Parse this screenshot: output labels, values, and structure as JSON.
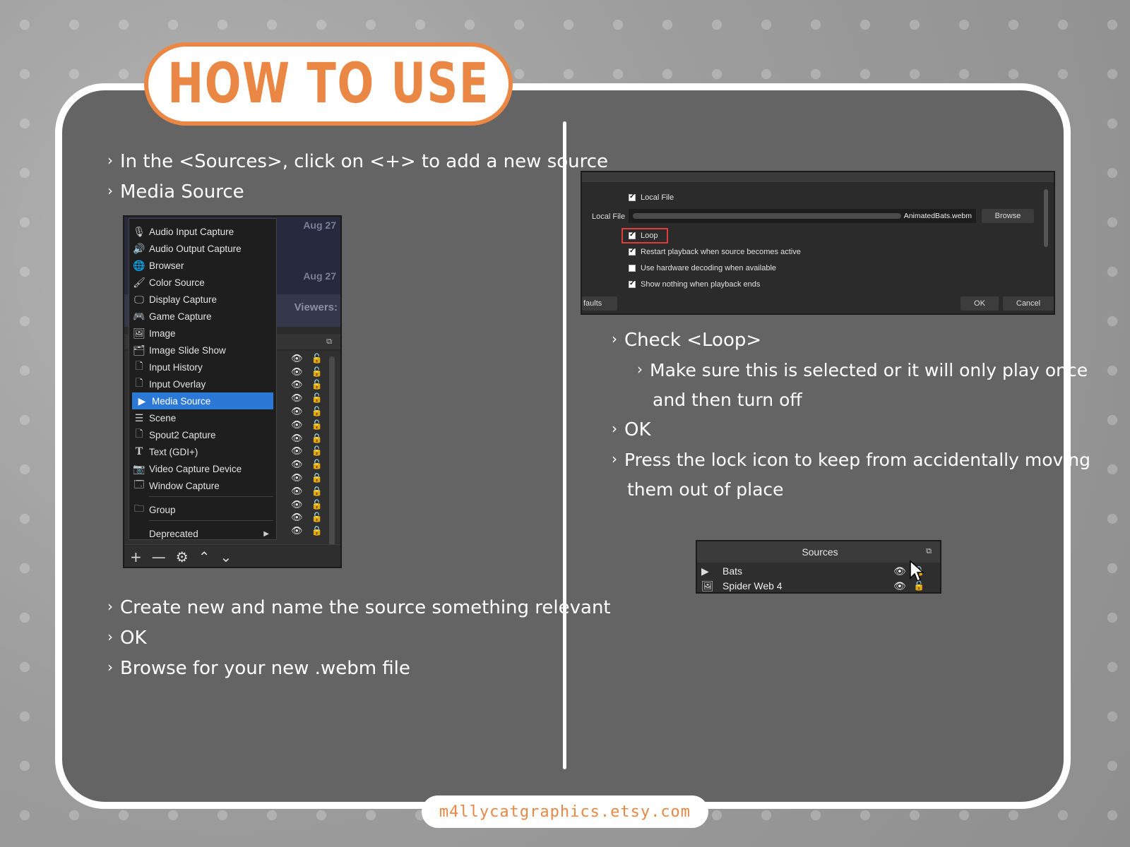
{
  "title": "HOW TO USE",
  "footer": "m4llycatgraphics.etsy.com",
  "left_steps": [
    "In the <Sources>, click on <+> to add a new source",
    "Media Source"
  ],
  "left_steps_bottom": [
    "Create new and name the source something relevant",
    "OK",
    "Browse for your new .webm file"
  ],
  "right_steps": {
    "check_loop": "Check <Loop>",
    "sub_line1": "Make sure this is selected or it will only play once",
    "sub_line2": "and then turn off",
    "ok": "OK",
    "lock_line1": "Press the lock icon to keep from accidentally moving",
    "lock_line2": "them out of place"
  },
  "obs_menu": {
    "background_dates": [
      "Aug 27",
      "Aug 27"
    ],
    "viewers_label": "Viewers:",
    "items": [
      {
        "icon": "mic-icon",
        "glyph": "🎙",
        "label": "Audio Input Capture"
      },
      {
        "icon": "speaker-icon",
        "glyph": "🔊",
        "label": "Audio Output Capture"
      },
      {
        "icon": "globe-icon",
        "glyph": "🌐",
        "label": "Browser"
      },
      {
        "icon": "brush-icon",
        "glyph": "🖌",
        "label": "Color Source"
      },
      {
        "icon": "monitor-icon",
        "glyph": "🖵",
        "label": "Display Capture"
      },
      {
        "icon": "gamepad-icon",
        "glyph": "🎮",
        "label": "Game Capture"
      },
      {
        "icon": "image-icon",
        "glyph": "🖼",
        "label": "Image"
      },
      {
        "icon": "slideshow-icon",
        "glyph": "🗂",
        "label": "Image Slide Show"
      },
      {
        "icon": "file-icon",
        "glyph": "🗋",
        "label": "Input History"
      },
      {
        "icon": "file-icon",
        "glyph": "🗋",
        "label": "Input Overlay"
      },
      {
        "icon": "play-icon",
        "glyph": "▶",
        "label": "Media Source",
        "selected": true
      },
      {
        "icon": "list-icon",
        "glyph": "☰",
        "label": "Scene"
      },
      {
        "icon": "file-icon",
        "glyph": "🗋",
        "label": "Spout2 Capture"
      },
      {
        "icon": "text-icon",
        "glyph": "T",
        "label": "Text (GDI+)"
      },
      {
        "icon": "camera-icon",
        "glyph": "📷",
        "label": "Video Capture Device"
      },
      {
        "icon": "window-icon",
        "glyph": "🗔",
        "label": "Window Capture"
      }
    ],
    "group_label": "Group",
    "deprecated_label": "Deprecated"
  },
  "properties_dialog": {
    "local_file_checkbox": "Local File",
    "local_file_label": "Local File",
    "file_path_visible": "AnimatedBats.webm",
    "browse_button": "Browse",
    "loop": "Loop",
    "restart": "Restart playback when source becomes active",
    "hw_decoding": "Use hardware decoding when available",
    "show_nothing": "Show nothing when playback ends",
    "defaults_button": "faults",
    "ok_button": "OK",
    "cancel_button": "Cancel",
    "checked": {
      "local_file": true,
      "loop": true,
      "restart": true,
      "hw_decoding": false,
      "show_nothing": true
    },
    "highlight_color": "#e03c3c"
  },
  "sources_dock": {
    "header": "Sources",
    "rows": [
      {
        "icon": "play-icon",
        "label": "Bats"
      },
      {
        "icon": "image-icon",
        "label": "Spider Web 4"
      }
    ]
  },
  "colors": {
    "accent": "#ea8744",
    "panel": "#646464",
    "selection": "#2c78d7"
  }
}
